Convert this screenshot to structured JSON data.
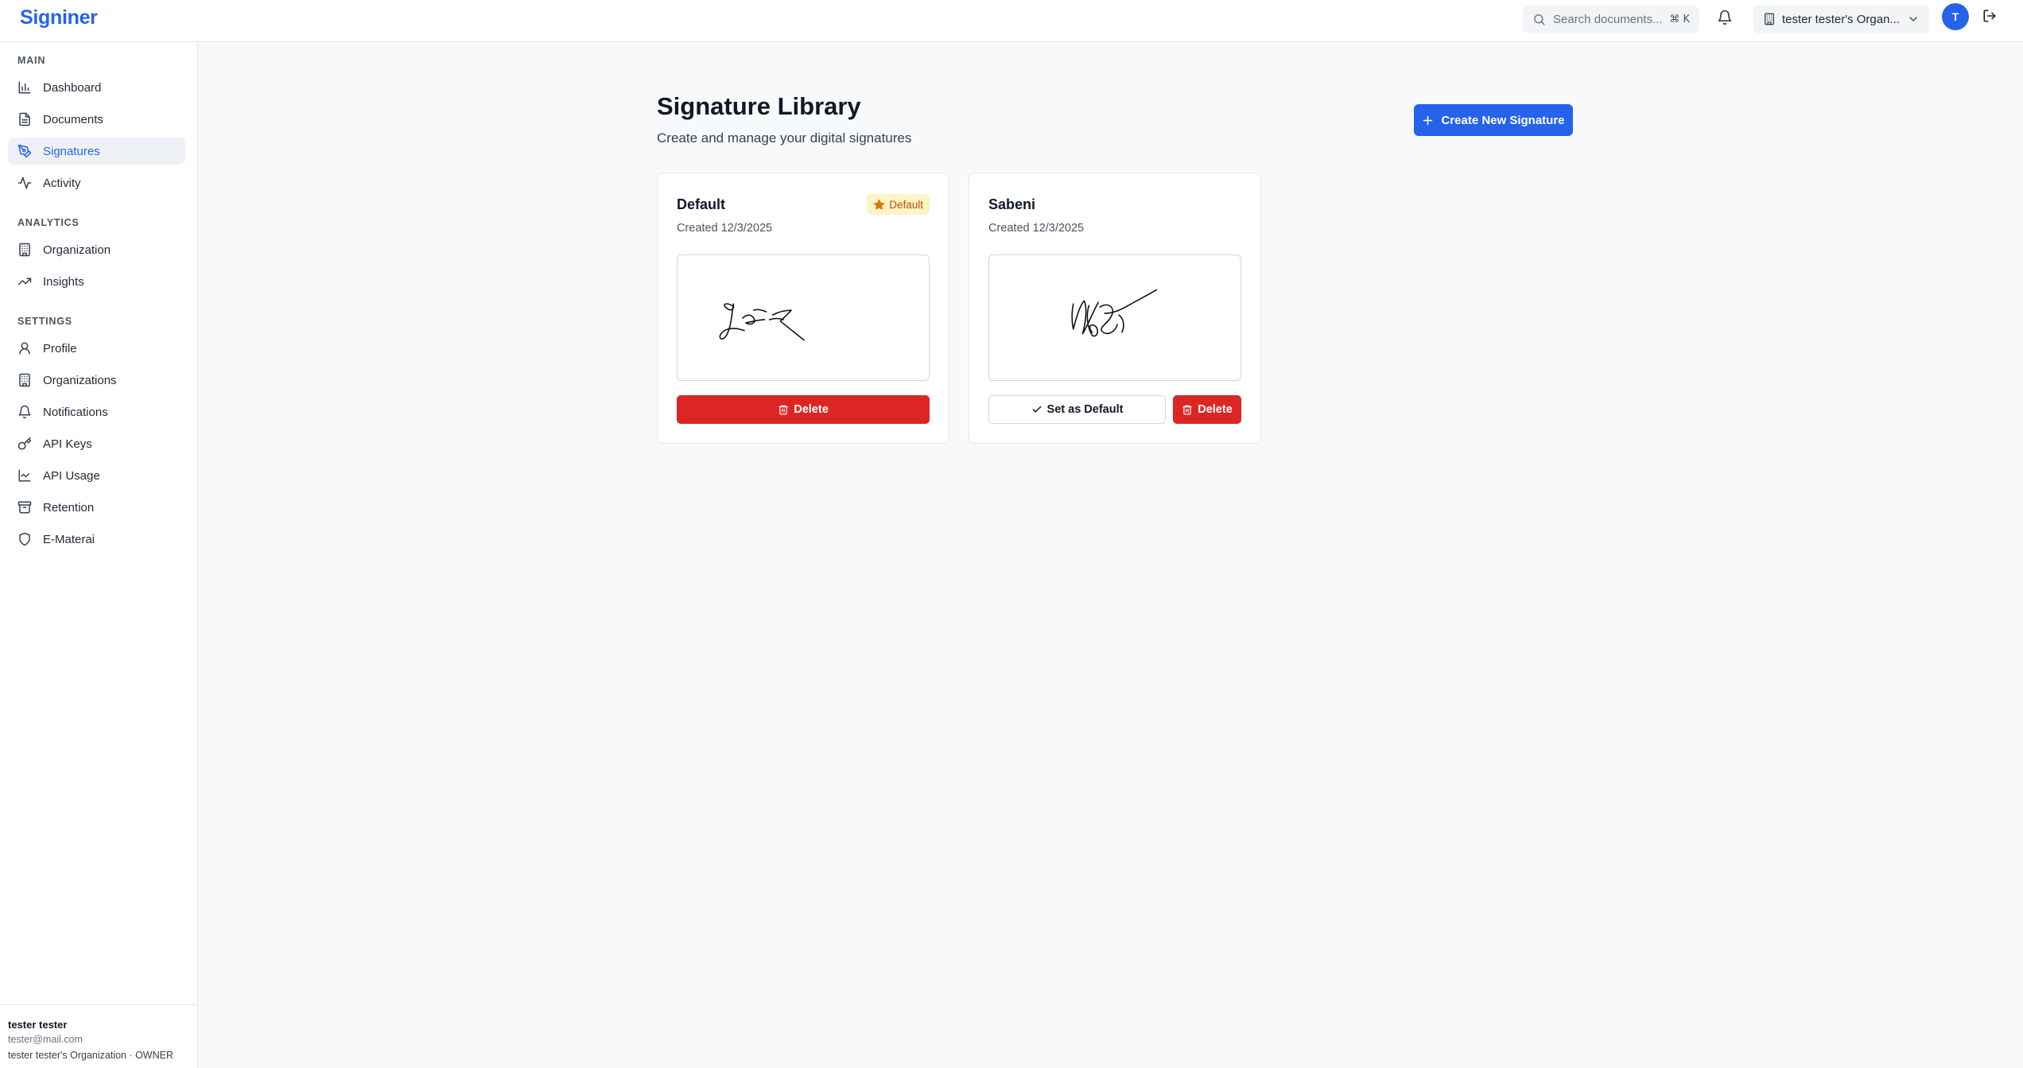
{
  "app": {
    "brand": "Signiner"
  },
  "topbar": {
    "search_placeholder": "Search documents...",
    "search_shortcut": "⌘ K",
    "org_selector": "tester tester's Organ...",
    "avatar_initial": "T"
  },
  "sidebar": {
    "sections": [
      {
        "label": "MAIN"
      },
      {
        "label": "ANALYTICS"
      },
      {
        "label": "SETTINGS"
      }
    ],
    "items": [
      {
        "label": "Dashboard",
        "icon": "bar-chart-icon"
      },
      {
        "label": "Documents",
        "icon": "document-icon"
      },
      {
        "label": "Signatures",
        "icon": "pen-tool-icon",
        "active": true
      },
      {
        "label": "Activity",
        "icon": "activity-icon"
      },
      {
        "label": "Organization",
        "icon": "building-icon"
      },
      {
        "label": "Insights",
        "icon": "trending-up-icon"
      },
      {
        "label": "Profile",
        "icon": "user-icon"
      },
      {
        "label": "Organizations",
        "icon": "building-icon"
      },
      {
        "label": "Notifications",
        "icon": "bell-icon"
      },
      {
        "label": "API Keys",
        "icon": "key-icon"
      },
      {
        "label": "API Usage",
        "icon": "line-chart-icon"
      },
      {
        "label": "Retention",
        "icon": "archive-icon"
      },
      {
        "label": "E-Materai",
        "icon": "shield-icon"
      }
    ],
    "footer": {
      "user_name": "tester tester",
      "user_email": "tester@mail.com",
      "org_role": "tester tester's Organization · OWNER"
    }
  },
  "main": {
    "title": "Signature Library",
    "subtitle": "Create and manage your digital signatures",
    "create_button": "Create New Signature",
    "signatures": [
      {
        "name": "Default",
        "created": "Created 12/3/2025",
        "is_default": true,
        "badge": "Default",
        "delete_label": "Delete"
      },
      {
        "name": "Sabeni",
        "created": "Created 12/3/2025",
        "is_default": false,
        "set_default_label": "Set as Default",
        "delete_label": "Delete"
      }
    ]
  },
  "colors": {
    "accent": "#2563eb",
    "danger": "#dc2626",
    "badge_bg": "#fef3c7",
    "badge_fg": "#b45309"
  }
}
